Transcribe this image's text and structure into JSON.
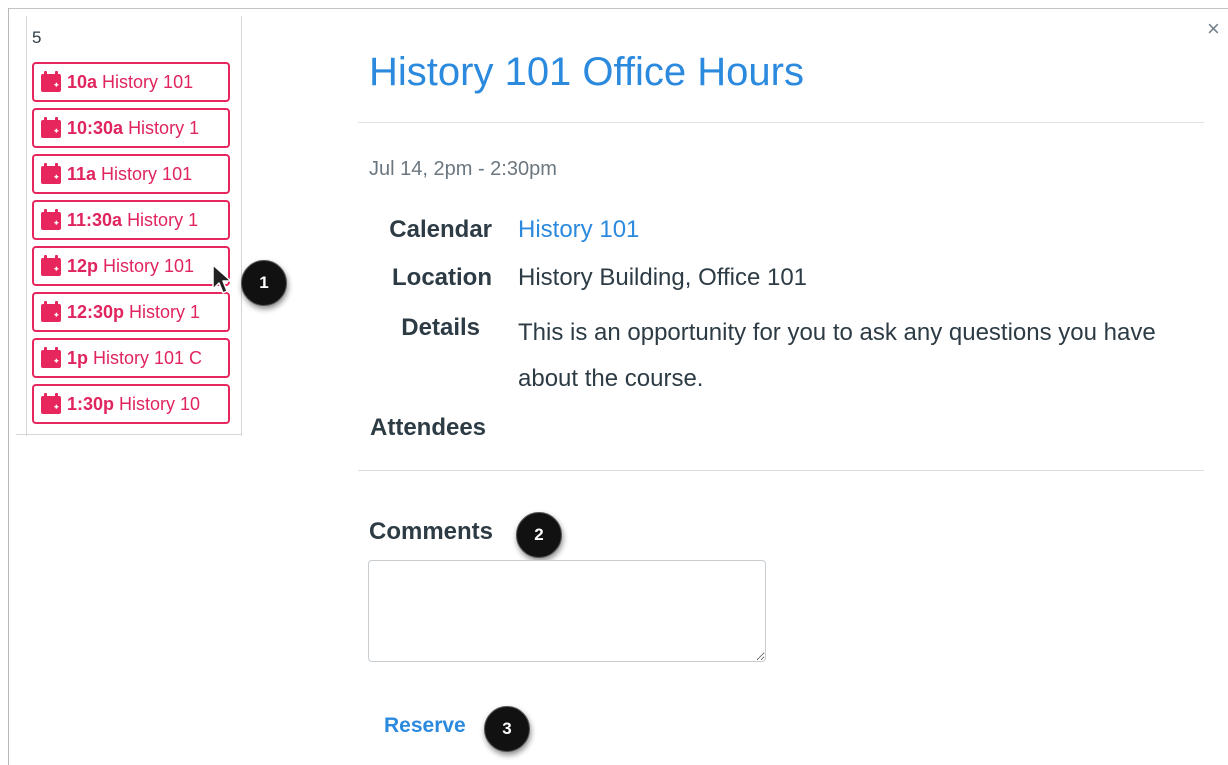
{
  "calendar": {
    "day_number": "5",
    "slots": [
      {
        "time": "10a",
        "label": "History 101"
      },
      {
        "time": "10:30a",
        "label": "History 1"
      },
      {
        "time": "11a",
        "label": "History 101"
      },
      {
        "time": "11:30a",
        "label": "History 1"
      },
      {
        "time": "12p",
        "label": "History 101"
      },
      {
        "time": "12:30p",
        "label": "History 1"
      },
      {
        "time": "1p",
        "label": "History 101 C"
      },
      {
        "time": "1:30p",
        "label": "History 10"
      }
    ],
    "slot_color": "#e8265e",
    "slot_icon": "calendar-plus-icon"
  },
  "dialog": {
    "close_label": "×",
    "title": "History 101 Office Hours",
    "date_range": "Jul 14, 2pm - 2:30pm",
    "calendar_label": "Calendar",
    "calendar_value": "History 101",
    "location_label": "Location",
    "location_value": "History Building, Office 101",
    "details_label": "Details",
    "details_value": "This is an opportunity for you to ask any questions you have about the course.",
    "attendees_label": "Attendees",
    "comments_label": "Comments",
    "comments_value": "",
    "reserve_label": "Reserve",
    "accent_color": "#2b8ade"
  },
  "callouts": [
    "1",
    "2",
    "3"
  ]
}
